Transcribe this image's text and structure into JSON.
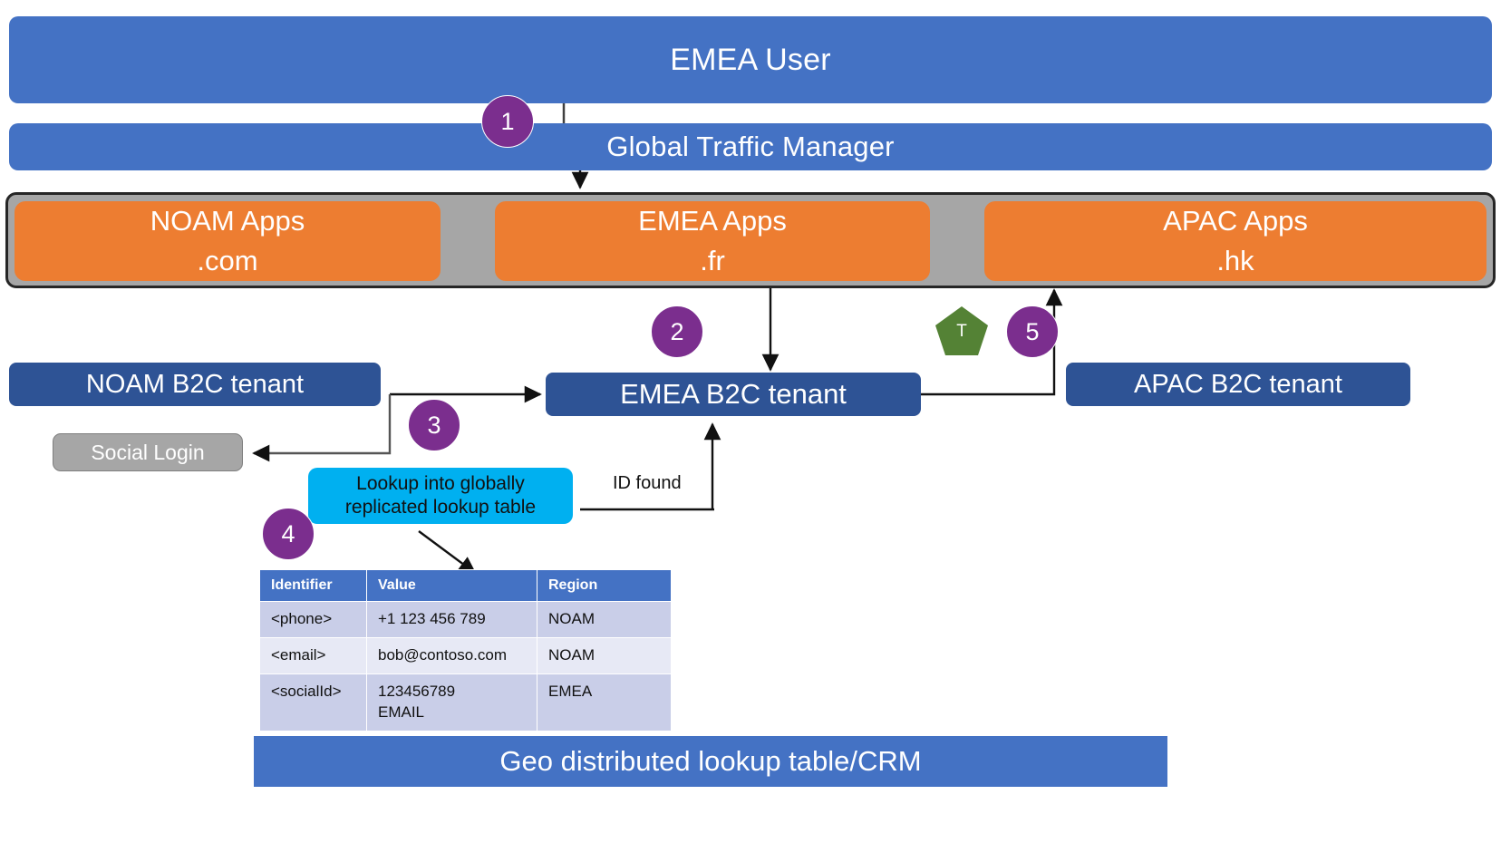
{
  "colors": {
    "banner_blue": "#4472C4",
    "app_orange": "#ED7D31",
    "container_grey": "#A6A6A6",
    "tenant_navy": "#2E5395",
    "step_purple": "#7B2E8E",
    "callout_cyan": "#00B0F0",
    "pentagon_green": "#548235",
    "table_header_blue": "#4472C4",
    "table_row_dark": "#C9CEE8",
    "table_row_light": "#E7E9F5"
  },
  "banners": {
    "user": "EMEA User",
    "traffic_manager": "Global Traffic Manager"
  },
  "apps": [
    {
      "name": "NOAM Apps",
      "domain": ".com"
    },
    {
      "name": "EMEA Apps",
      "domain": ".fr"
    },
    {
      "name": "APAC Apps",
      "domain": ".hk"
    }
  ],
  "tenants": {
    "noam": "NOAM B2C tenant",
    "emea": "EMEA B2C tenant",
    "apac": "APAC B2C tenant"
  },
  "social_login": "Social Login",
  "callout": {
    "line1": "Lookup into globally",
    "line2": "replicated lookup table"
  },
  "annotations": {
    "id_found": "ID found"
  },
  "pentagon": {
    "label": "T"
  },
  "steps": {
    "s1": "1",
    "s2": "2",
    "s3": "3",
    "s4": "4",
    "s5": "5"
  },
  "lookup_table": {
    "headers": [
      "Identifier",
      "Value",
      "Region"
    ],
    "rows": [
      {
        "identifier": "<phone>",
        "value": "+1 123 456 789",
        "region": "NOAM"
      },
      {
        "identifier": "<email>",
        "value": "bob@contoso.com",
        "region": "NOAM"
      },
      {
        "identifier": "<socialId>",
        "value": "123456789\nEMAIL",
        "region": "EMEA"
      }
    ]
  },
  "bottom_bar": "Geo distributed lookup table/CRM"
}
